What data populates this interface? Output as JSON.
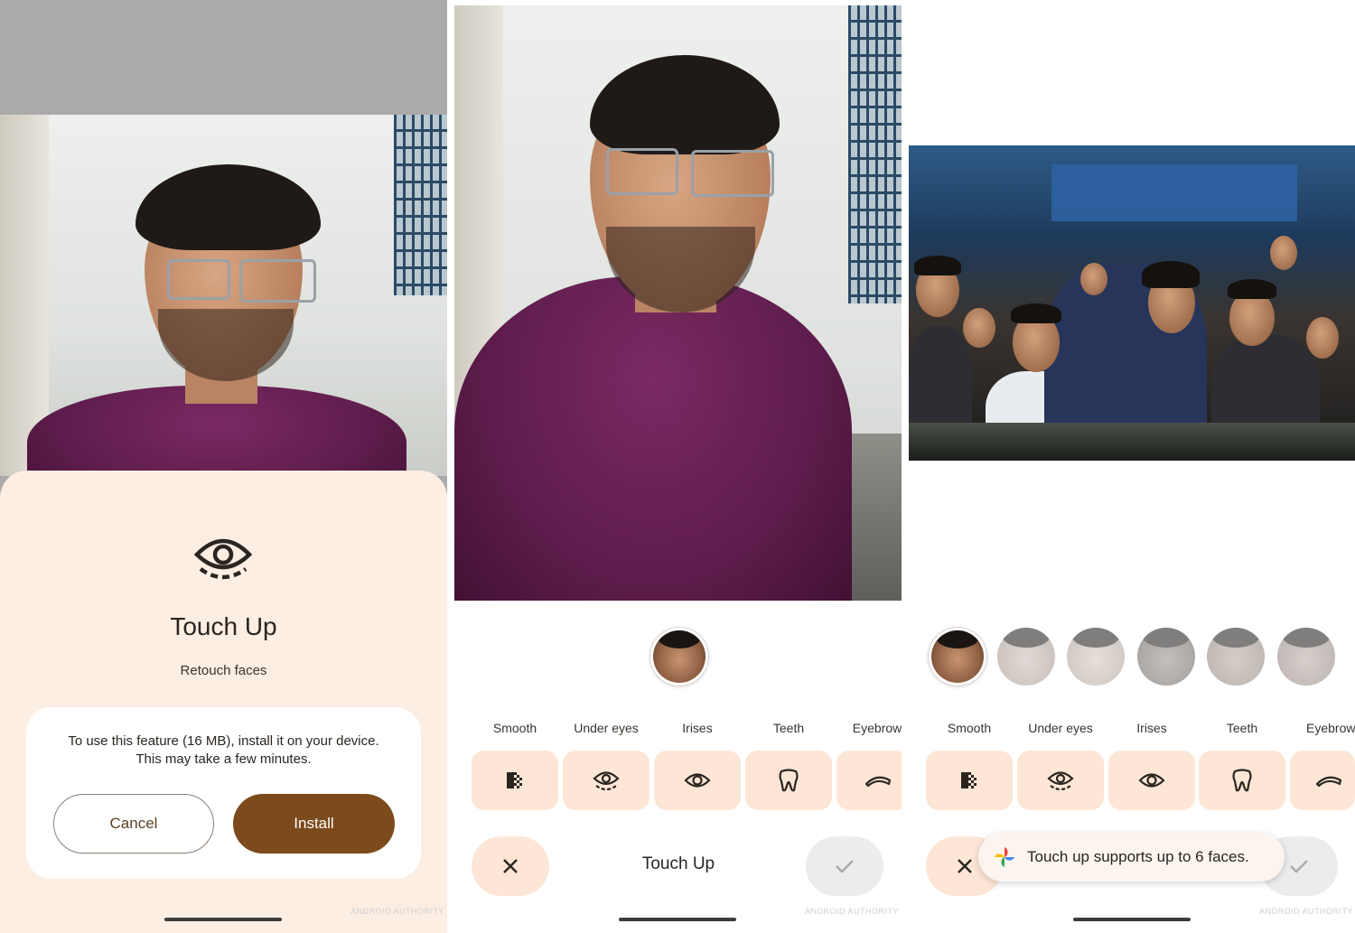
{
  "screen1": {
    "sheet_title": "Touch Up",
    "sheet_subtitle": "Retouch faces",
    "info_line1": "To use this feature (16 MB), install it on your device.",
    "info_line2": "This may take a few minutes.",
    "cancel_label": "Cancel",
    "install_label": "Install",
    "watermark": "ANDROID AUTHORITY"
  },
  "screen2": {
    "tools": [
      {
        "label": "Smooth",
        "icon": "smooth-icon"
      },
      {
        "label": "Under eyes",
        "icon": "under-eyes-icon"
      },
      {
        "label": "Irises",
        "icon": "irises-icon"
      },
      {
        "label": "Teeth",
        "icon": "teeth-icon"
      },
      {
        "label": "Eyebrow",
        "icon": "eyebrow-icon"
      }
    ],
    "bottom_title": "Touch Up",
    "watermark": "ANDROID AUTHORITY"
  },
  "screen3": {
    "tools": [
      {
        "label": "Smooth",
        "icon": "smooth-icon"
      },
      {
        "label": "Under eyes",
        "icon": "under-eyes-icon"
      },
      {
        "label": "Irises",
        "icon": "irises-icon"
      },
      {
        "label": "Teeth",
        "icon": "teeth-icon"
      },
      {
        "label": "Eyebrow",
        "icon": "eyebrow-icon"
      }
    ],
    "face_count_shown": 6,
    "toast_text": "Touch up supports up to 6 faces.",
    "watermark": "ANDROID AUTHORITY"
  },
  "colors": {
    "sheet_bg": "#fdeee4",
    "accent_brown": "#7d4a1c",
    "tool_bg": "#fde6d6"
  }
}
